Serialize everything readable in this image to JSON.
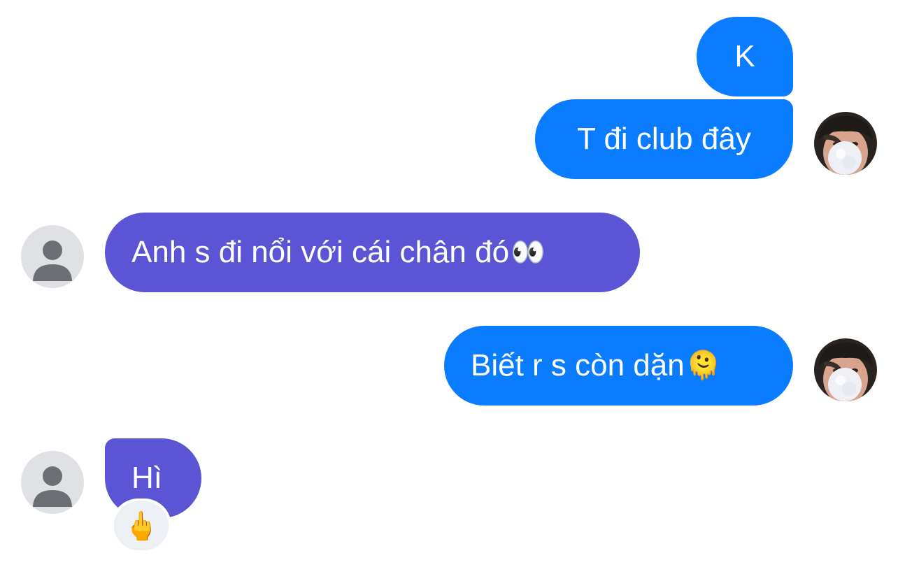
{
  "messages": [
    {
      "id": "m1",
      "sender": "me",
      "text": "K",
      "emoji": ""
    },
    {
      "id": "m2",
      "sender": "me",
      "text": "T đi club đây",
      "emoji": ""
    },
    {
      "id": "m3",
      "sender": "them",
      "text": "Anh s đi nổi với cái chân đó",
      "emoji": "👀"
    },
    {
      "id": "m4",
      "sender": "me",
      "text": "Biết r s còn dặn",
      "emoji": "🫠"
    },
    {
      "id": "m5",
      "sender": "them",
      "text": "Hì",
      "emoji": "",
      "reaction": "🖕"
    }
  ],
  "avatars": {
    "me": "profile-photo-avatar",
    "them": "default-person-avatar"
  },
  "colors": {
    "outgoing_bubble": "#0a7cff",
    "incoming_bubble": "#5b55d6",
    "avatar_placeholder_bg": "#dfe1e5",
    "avatar_placeholder_fg": "#6b6e72",
    "reaction_bg": "#eceff3"
  }
}
